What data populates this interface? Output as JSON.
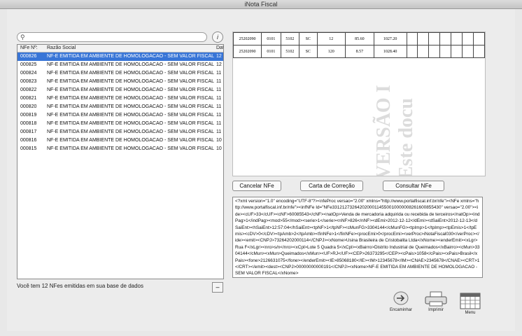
{
  "window": {
    "title": "iNota Fiscal"
  },
  "search": {
    "placeholder": ""
  },
  "info_button": {
    "label": "i"
  },
  "list": {
    "columns": [
      "NFe Nº:",
      "Razão Social",
      "Dat"
    ],
    "rows": [
      {
        "nfe": "000826",
        "razao": "NF-E EMITIDA EM AMBIENTE DE HOMOLOGACAO - SEM VALOR FISCAL",
        "dat": "12"
      },
      {
        "nfe": "000825",
        "razao": "NF-E EMITIDA EM AMBIENTE DE HOMOLOGACAO - SEM VALOR FISCAL",
        "dat": "12"
      },
      {
        "nfe": "000824",
        "razao": "NF-E EMITIDA EM AMBIENTE DE HOMOLOGACAO - SEM VALOR FISCAL",
        "dat": "11"
      },
      {
        "nfe": "000823",
        "razao": "NF-E EMITIDA EM AMBIENTE DE HOMOLOGACAO - SEM VALOR FISCAL",
        "dat": "11"
      },
      {
        "nfe": "000822",
        "razao": "NF-E EMITIDA EM AMBIENTE DE HOMOLOGACAO - SEM VALOR FISCAL",
        "dat": "11"
      },
      {
        "nfe": "000821",
        "razao": "NF-E EMITIDA EM AMBIENTE DE HOMOLOGACAO - SEM VALOR FISCAL",
        "dat": "11"
      },
      {
        "nfe": "000820",
        "razao": "NF-E EMITIDA EM AMBIENTE DE HOMOLOGACAO - SEM VALOR FISCAL",
        "dat": "11"
      },
      {
        "nfe": "000819",
        "razao": "NF-E EMITIDA EM AMBIENTE DE HOMOLOGACAO - SEM VALOR FISCAL",
        "dat": "11"
      },
      {
        "nfe": "000818",
        "razao": "NF-E EMITIDA EM AMBIENTE DE HOMOLOGACAO - SEM VALOR FISCAL",
        "dat": "11"
      },
      {
        "nfe": "000817",
        "razao": "NF-E EMITIDA EM AMBIENTE DE HOMOLOGACAO - SEM VALOR FISCAL",
        "dat": "11"
      },
      {
        "nfe": "000816",
        "razao": "NF-E EMITIDA EM AMBIENTE DE HOMOLOGACAO - SEM VALOR FISCAL",
        "dat": "10"
      },
      {
        "nfe": "000815",
        "razao": "NF-E EMITIDA EM AMBIENTE DE HOMOLOGACAO - SEM VALOR FISCAL",
        "dat": "10"
      }
    ]
  },
  "status": {
    "text": "Você tem 12 NFes emitidas em sua base de dados"
  },
  "minus_button": {
    "label": "–"
  },
  "preview": {
    "items": [
      [
        "25202090",
        "0101",
        "5102",
        "SC",
        "12",
        "85.60",
        "1027.20",
        "",
        "",
        "",
        "",
        "",
        "",
        ""
      ],
      [
        "25202090",
        "0101",
        "5102",
        "SC",
        "120",
        "8.57",
        "1028.40",
        "",
        "",
        "",
        "",
        "",
        "",
        ""
      ]
    ],
    "watermark_line1": "VERSÃO I",
    "watermark_line2": "Este docu"
  },
  "actions": {
    "cancel": "Cancelar NFe",
    "correction": "Carta de Correção",
    "consult": "Consultar NFe"
  },
  "xml": {
    "text": "<?xml version=\"1.0\" encoding=\"UTF-8\"?><nfeProc versao=\"2.00\" xmlns=\"http://www.portalfiscal.inf.br/nfe\"><NFe xmlns=\"http://www.portalfiscal.inf.br/nfe\"><infNFe Id=\"NFe33121273264202000114550010000008261600855430\" versao=\"2.00\"><ide><cUF>33</cUF><cNF>60085543</cNF><natOp>Venda de mercadoria adquirida ou recebida de terceiros</natOp><indPag>1</indPag><mod>55</mod><serie>1</serie><nNF>826</nNF><dEmi>2012-12-12</dEmi><dSaiEnt>2012-12-13</dSaiEnt><hSaiEnt>12:57:04</hSaiEnt><tpNF>1</tpNF><cMunFG>3304144</cMunFG><tpImp>1</tpImp><tpEmis>1</tpEmis><cDV>0</cDV><tpAmb>2</tpAmb><finNFe>1</finNFe><procEmi>0</procEmi><verProc>iNotaFiscal030</verProc></ide><emit><CNPJ>73264202000114</CNPJ><xNome>Usina Brasileira de Cristobalita Ltda</xNome><enderEmit><xLgr>Rua F</xLgr><nro>s/n</nro><xCpl>Lote 5 Quadra 5</xCpl><xBairro>Distrito Industrial de Queimados</xBairro><cMun>3304144</cMun><xMun>Queimados</xMun><UF>RJ</UF><CEP>26373295</CEP><cPais>1058</cPais><xPais>Brasil</xPais><fone>2126631075</fone></enderEmit><IE>85068180</IE><IM>12345678</IM><CNAE>2345678</CNAE><CRT>1</CRT></emit><dest><CNPJ>00000000000191</CNPJ><xNome>NF-E EMITIDA EM AMBIENTE DE HOMOLOGACAO - SEM VALOR FISCAL</xNome>"
  },
  "toolbar": {
    "forward": "Encaminhar",
    "print": "Imprimir",
    "menu": "Menu"
  }
}
